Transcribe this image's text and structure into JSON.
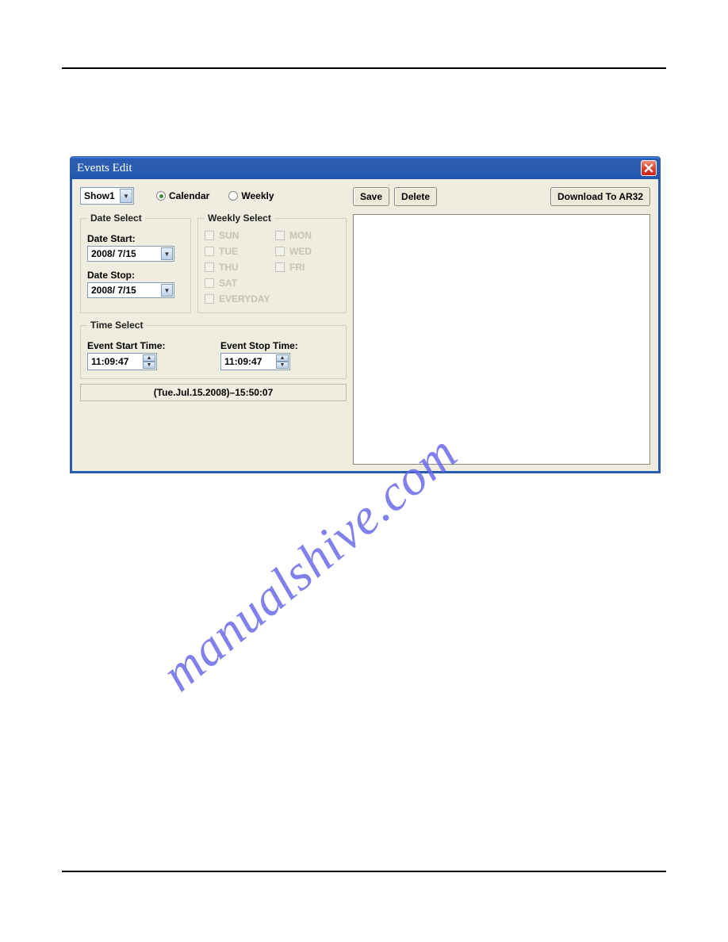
{
  "window": {
    "title": "Events Edit"
  },
  "toolbar": {
    "show_select": "Show1",
    "radio_calendar": "Calendar",
    "radio_weekly": "Weekly",
    "save": "Save",
    "delete": "Delete",
    "download": "Download To AR32"
  },
  "date_select": {
    "legend": "Date Select",
    "start_label": "Date Start:",
    "start_value": "2008/ 7/15",
    "stop_label": "Date Stop:",
    "stop_value": "2008/ 7/15"
  },
  "weekly_select": {
    "legend": "Weekly Select",
    "days": {
      "sun": "SUN",
      "mon": "MON",
      "tue": "TUE",
      "wed": "WED",
      "thu": "THU",
      "fri": "FRI",
      "sat": "SAT",
      "every": "EVERYDAY"
    }
  },
  "time_select": {
    "legend": "Time Select",
    "start_label": "Event Start Time:",
    "start_value": "11:09:47",
    "stop_label": "Event Stop Time:",
    "stop_value": "11:09:47"
  },
  "status": "(Tue.Jul.15.2008)–15:50:07",
  "watermark": "manualshive.com"
}
